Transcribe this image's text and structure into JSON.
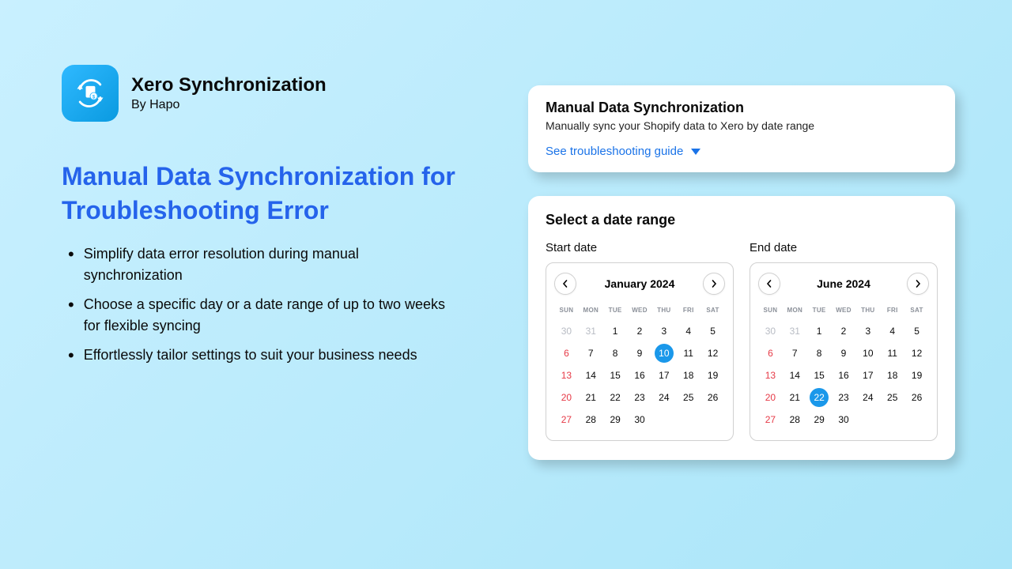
{
  "app": {
    "title": "Xero Synchronization",
    "byline": "By Hapo"
  },
  "headline": "Manual Data Synchronization for Troubleshooting Error",
  "bullets": [
    "Simplify data error resolution during manual synchronization",
    "Choose a specific day or a date range of up to two weeks for flexible syncing",
    "Effortlessly tailor settings to suit your business needs"
  ],
  "panel": {
    "title": "Manual Data Synchronization",
    "subtitle": "Manually sync your Shopify data to Xero by date range",
    "link": "See troubleshooting guide"
  },
  "range": {
    "title": "Select a date range",
    "start_label": "Start date",
    "end_label": "End date",
    "dow": [
      "SUN",
      "MON",
      "TUE",
      "WED",
      "THU",
      "FRI",
      "SAT"
    ],
    "startCal": {
      "month": "January 2024",
      "leading": [
        30,
        31
      ],
      "days": 30,
      "selected": 10
    },
    "endCal": {
      "month": "June 2024",
      "leading": [
        30,
        31
      ],
      "days": 30,
      "selected": 22
    }
  }
}
